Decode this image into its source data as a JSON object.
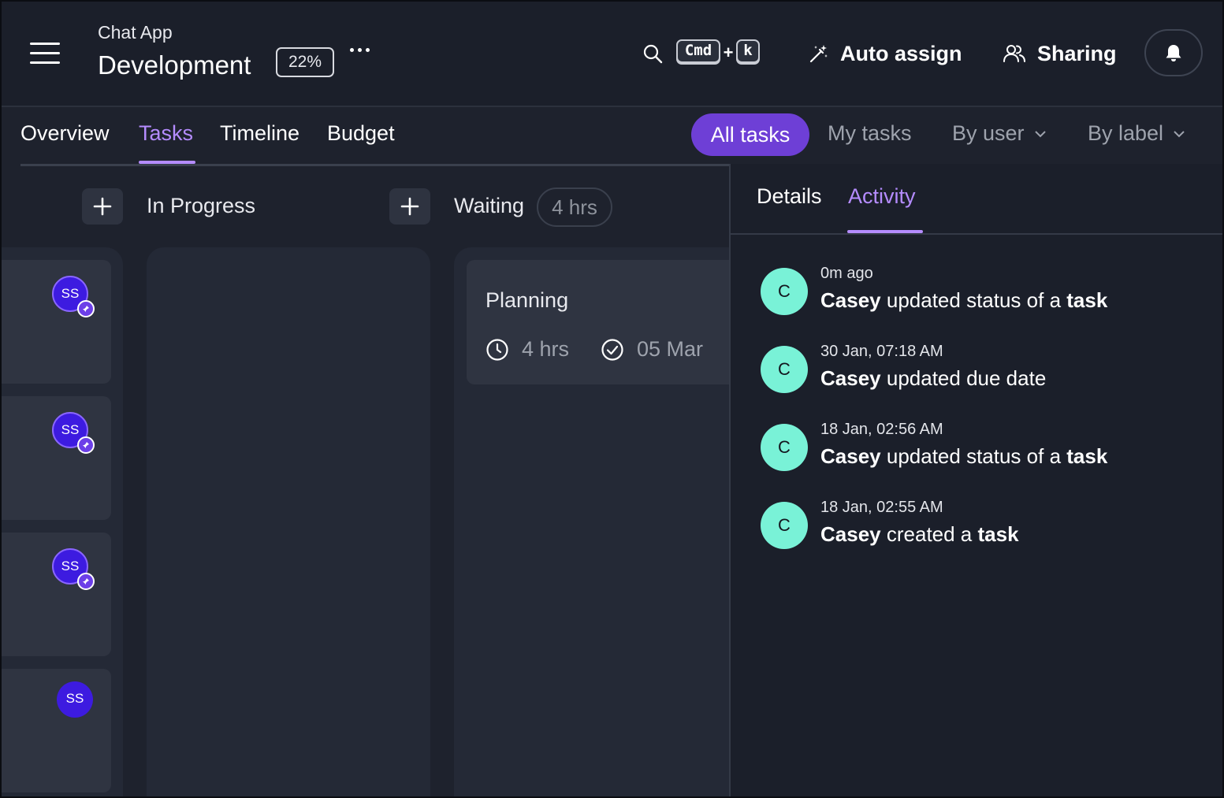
{
  "header": {
    "app_name": "Chat App",
    "project_title": "Development",
    "progress": "22%",
    "shortcut_key_1": "Cmd",
    "shortcut_plus": "+",
    "shortcut_key_2": "k",
    "auto_assign_label": "Auto assign",
    "sharing_label": "Sharing"
  },
  "tabs": [
    {
      "label": "Overview",
      "active": false
    },
    {
      "label": "Tasks",
      "active": true
    },
    {
      "label": "Timeline",
      "active": false
    },
    {
      "label": "Budget",
      "active": false
    }
  ],
  "filters": {
    "all_tasks": "All tasks",
    "my_tasks": "My tasks",
    "by_user": "By user",
    "by_label": "By label"
  },
  "board": {
    "columns": [
      {
        "title": "In Progress"
      },
      {
        "title": "Waiting",
        "hours": "4 hrs"
      }
    ],
    "left_cards": [
      {
        "avatar": "SS",
        "pinned": true
      },
      {
        "avatar": "SS",
        "pinned": true
      },
      {
        "avatar": "SS",
        "pinned": true
      },
      {
        "avatar": "SS",
        "pinned": false
      }
    ],
    "waiting_card": {
      "title": "Planning",
      "hours": "4 hrs",
      "due": "05 Mar"
    }
  },
  "panel": {
    "tabs": [
      {
        "label": "Details",
        "active": false
      },
      {
        "label": "Activity",
        "active": true
      }
    ],
    "activity": [
      {
        "avatar": "C",
        "time": "0m ago",
        "user": "Casey",
        "action": "updated status of a",
        "object": "task"
      },
      {
        "avatar": "C",
        "time": "30 Jan, 07:18 AM",
        "user": "Casey",
        "action": "updated due date",
        "object": ""
      },
      {
        "avatar": "C",
        "time": "18 Jan, 02:56 AM",
        "user": "Casey",
        "action": "updated status of a",
        "object": "task"
      },
      {
        "avatar": "C",
        "time": "18 Jan, 02:55 AM",
        "user": "Casey",
        "action": "created a",
        "object": "task"
      }
    ]
  },
  "colors": {
    "background": "#1e222d",
    "accent": "#b58cff",
    "pill": "#6e3fd6",
    "avatar_teal": "#79f2d7",
    "avatar_purple": "#3d1be0"
  }
}
